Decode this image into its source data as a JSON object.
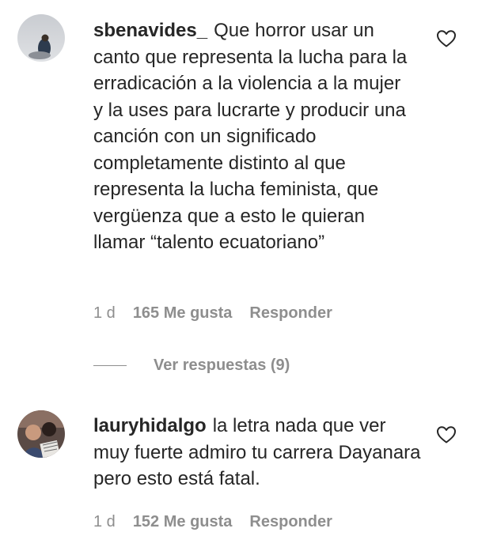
{
  "comments": [
    {
      "username": "sbenavides_",
      "text": "Que horror usar un canto que representa la lucha para la erradicación a la violencia a la mujer y la uses para lucrarte y producir una canción con un significado completamente distinto al que representa la lucha feminista, que vergüenza que a esto le quieran llamar “talento ecuatoriano”",
      "time": "1 d",
      "likes": "165 Me gusta",
      "reply": "Responder",
      "view_replies": "Ver respuestas (9)",
      "heart_icon": "heart-outline-icon"
    },
    {
      "username": "lauryhidalgo",
      "text": "la letra nada que ver muy fuerte admiro tu carrera Dayanara pero esto está fatal.",
      "time": "1 d",
      "likes": "152 Me gusta",
      "reply": "Responder",
      "heart_icon": "heart-outline-icon"
    }
  ]
}
